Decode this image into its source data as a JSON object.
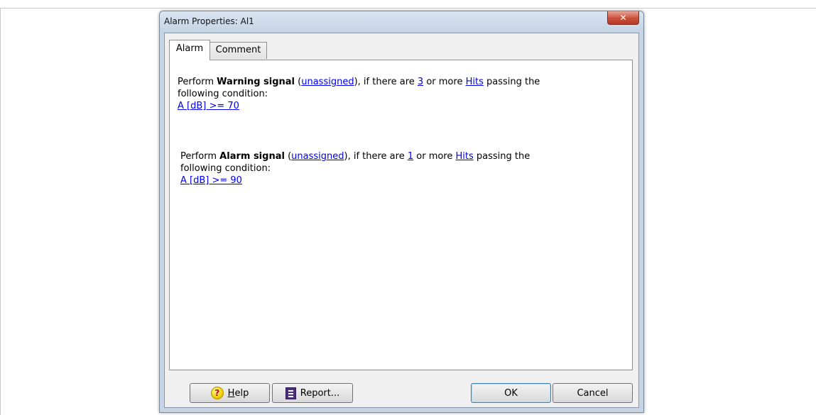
{
  "window": {
    "title": "Alarm Properties: Al1",
    "close_icon": "close-icon"
  },
  "tabs": [
    {
      "label": "Alarm",
      "active": true
    },
    {
      "label": "Comment",
      "active": false
    }
  ],
  "warning_rule": {
    "prefix": "Perform ",
    "action": "Warning signal",
    "open_paren": " (",
    "assignment": "unassigned",
    "mid1": "), if there are ",
    "count": "3",
    "mid2": " or more ",
    "hits": "Hits",
    "suffix": " passing the",
    "line2": "following condition:",
    "condition": "A [dB] >= 70"
  },
  "alarm_rule": {
    "prefix": "Perform ",
    "action": "Alarm signal",
    "open_paren": " (",
    "assignment": "unassigned",
    "mid1": "), if there are ",
    "count": "1",
    "mid2": " or more ",
    "hits": "Hits",
    "suffix": " passing the",
    "line2": "following condition:",
    "condition": "A [dB] >= 90"
  },
  "buttons": {
    "help": "Help",
    "help_icon": "help-icon",
    "report": "Report...",
    "report_icon": "report-icon",
    "ok": "OK",
    "cancel": "Cancel"
  }
}
